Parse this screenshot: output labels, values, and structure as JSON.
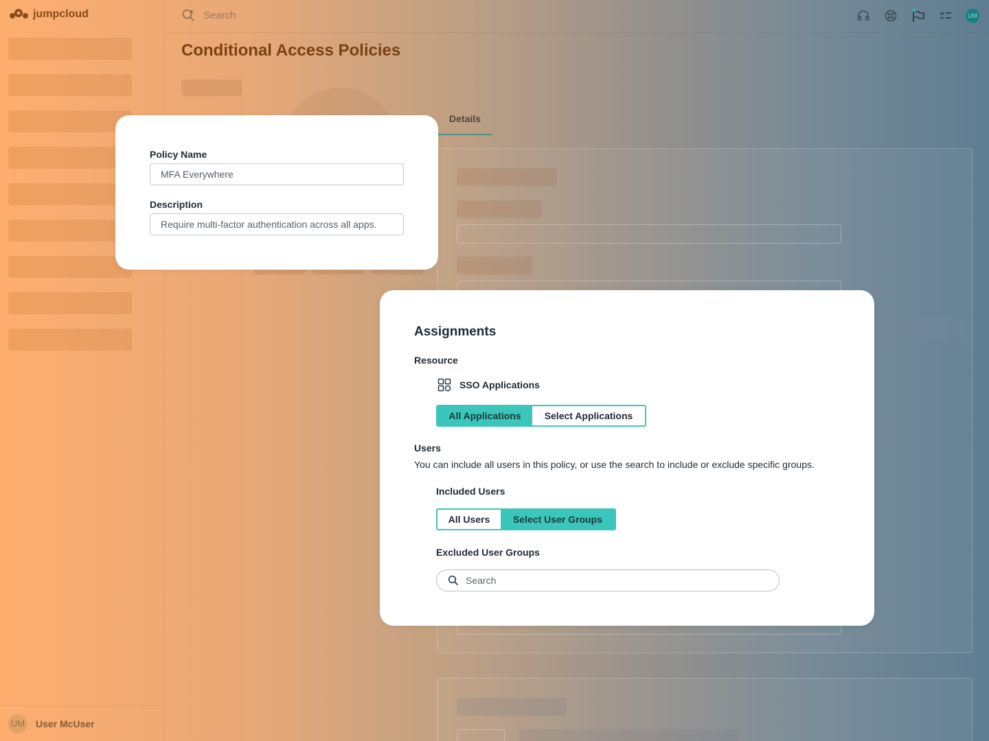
{
  "app": {
    "logo_text": "jumpcloud"
  },
  "topbar": {
    "search_placeholder": "Search",
    "avatar_initials": "UM"
  },
  "page": {
    "title": "Conditional Access Policies"
  },
  "tabs": {
    "details": "Details"
  },
  "sidebar": {
    "user_initials": "UM",
    "user_name": "User McUser"
  },
  "policy": {
    "name_label": "Policy Name",
    "name_value": "MFA Everywhere",
    "description_label": "Description",
    "description_value": "Require multi-factor authentication across all apps."
  },
  "assignments": {
    "title": "Assignments",
    "resource_label": "Resource",
    "resource_name": "SSO Applications",
    "app_options": [
      "All Applications",
      "Select Applications"
    ],
    "app_selected": "All Applications",
    "users_label": "Users",
    "users_help": "You can include all users in this policy, or use the search to include or exclude specific groups.",
    "included_label": "Included Users",
    "user_options": [
      "All Users",
      "Select User Groups"
    ],
    "user_selected": "Select User Groups",
    "excluded_label": "Excluded User Groups",
    "excluded_search_placeholder": "Search"
  },
  "colors": {
    "accent": "#3cc6bb",
    "brand": "#8a4a17"
  },
  "icons": [
    "jumpcloud-logo-icon",
    "search-icon",
    "headset-icon",
    "help-wheel-icon",
    "flag-icon",
    "checklist-icon",
    "grid-apps-icon"
  ]
}
